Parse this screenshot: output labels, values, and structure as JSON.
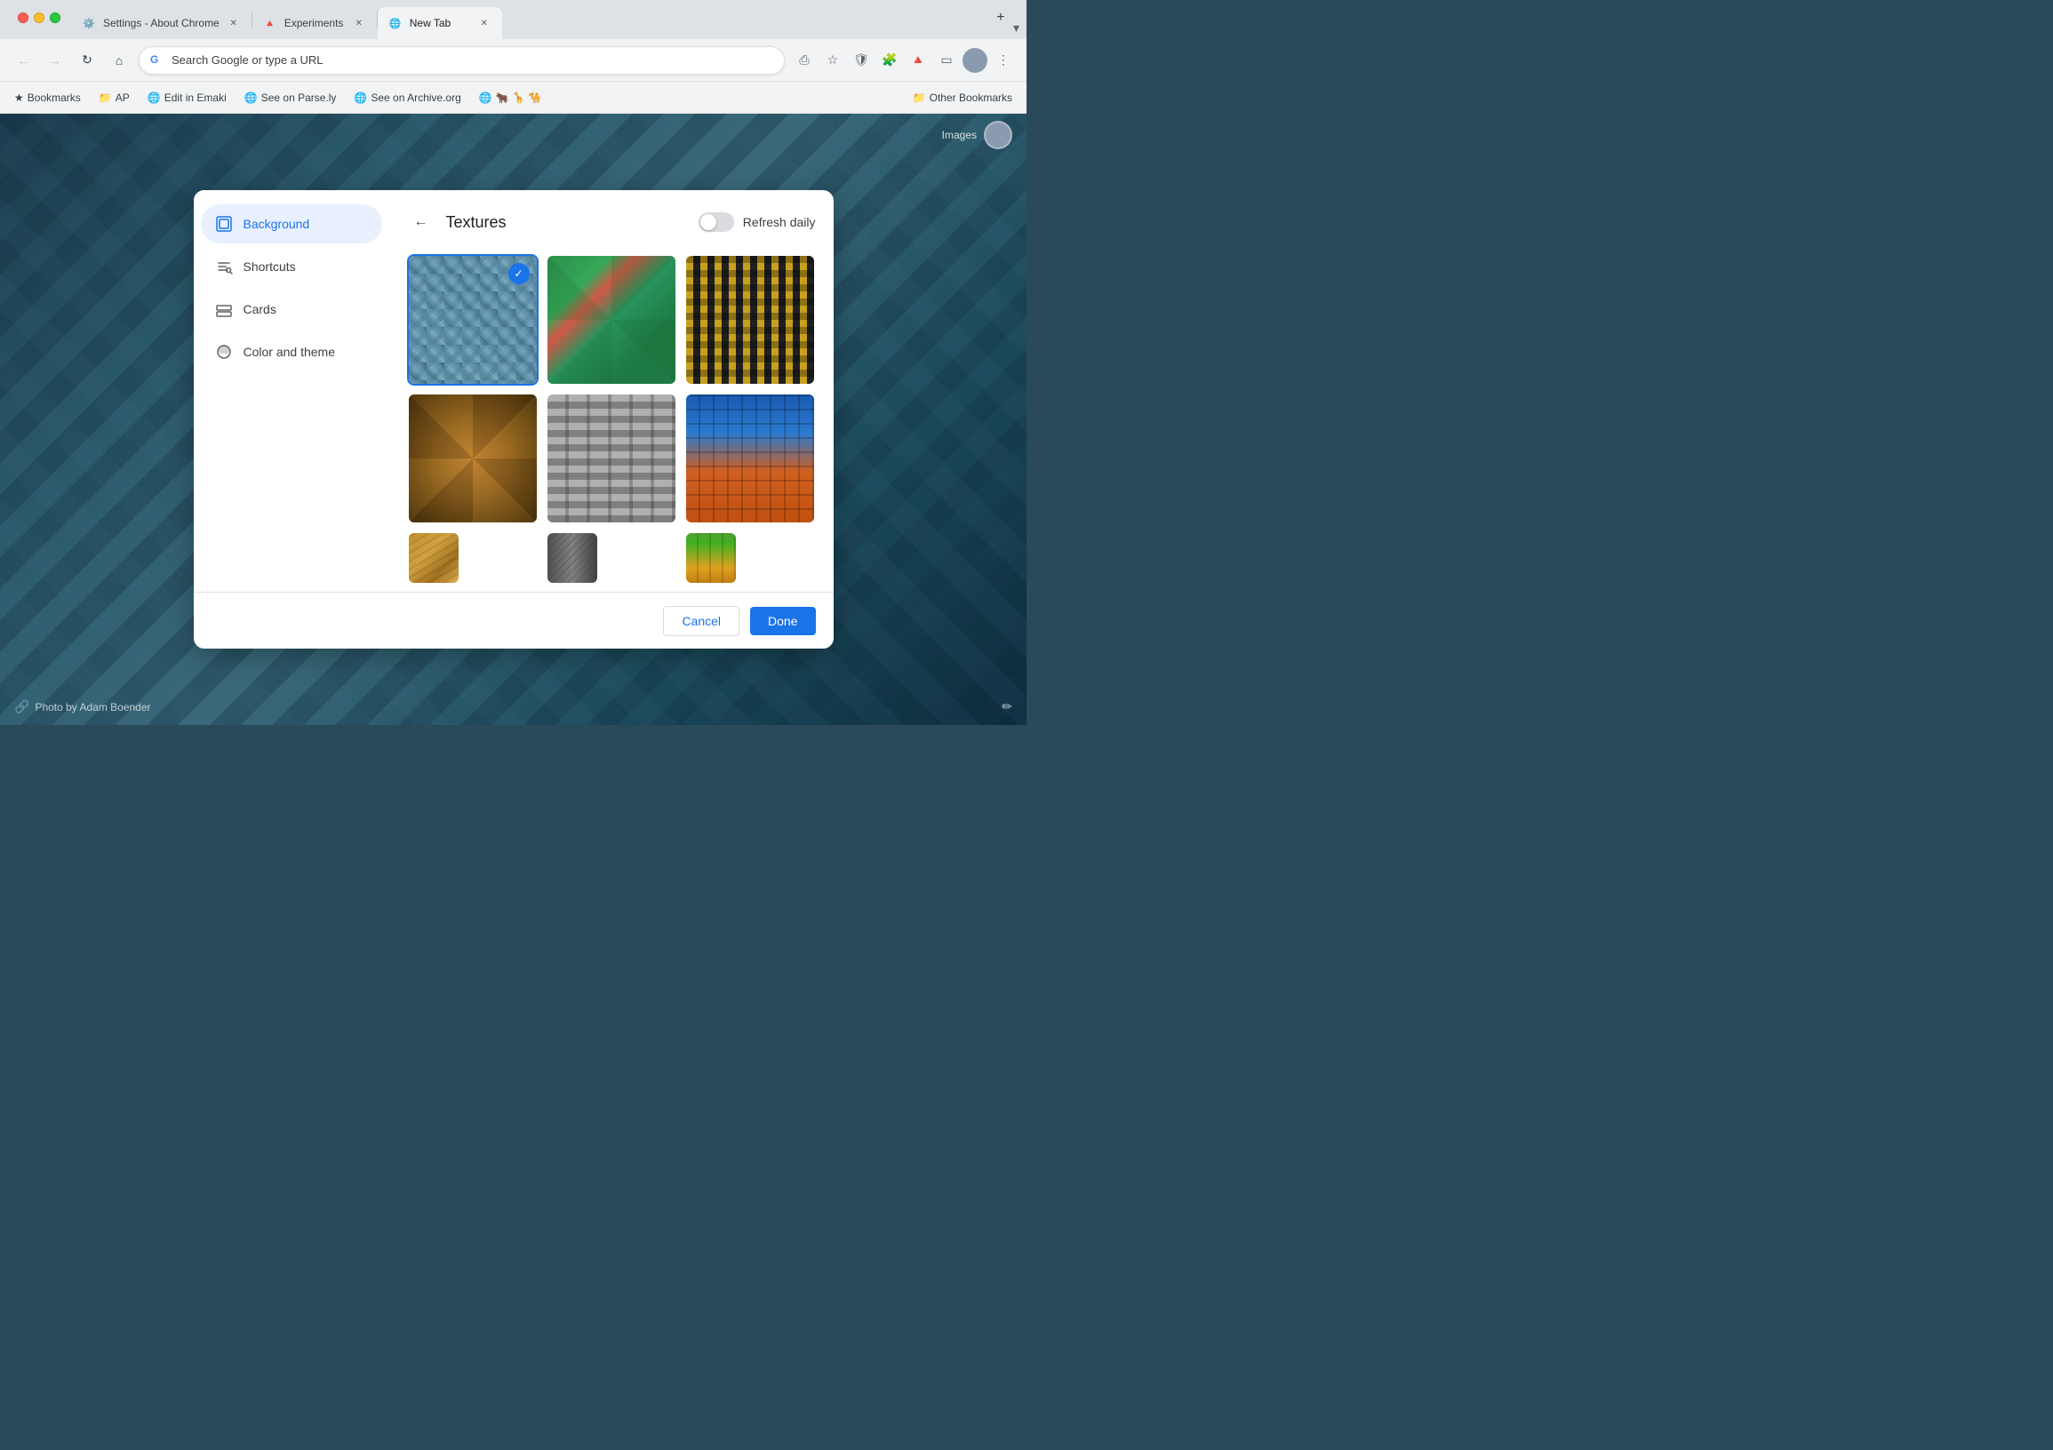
{
  "browser": {
    "tabs": [
      {
        "id": "settings",
        "icon": "⚙️",
        "title": "Settings - About Chrome",
        "active": false
      },
      {
        "id": "experiments",
        "icon": "🔺",
        "title": "Experiments",
        "active": false
      },
      {
        "id": "newtab",
        "icon": "🌐",
        "title": "New Tab",
        "active": true
      }
    ],
    "url": "Search Google or type a URL",
    "bookmarks": [
      {
        "id": "bookmarks",
        "icon": "★",
        "label": "Bookmarks"
      },
      {
        "id": "ap",
        "icon": "📁",
        "label": "AP"
      },
      {
        "id": "edit-emaki",
        "icon": "🌐",
        "label": "Edit in Emaki"
      },
      {
        "id": "parse-ly",
        "icon": "🌐",
        "label": "See on Parse.ly"
      },
      {
        "id": "archive",
        "icon": "🌐",
        "label": "See on Archive.org"
      },
      {
        "id": "animals",
        "icon": "🌐",
        "label": "🐂 🦒 🐪"
      }
    ],
    "other_bookmarks": "Other Bookmarks"
  },
  "ntp": {
    "images_link": "Images",
    "photo_credit": "Photo by Adam Boender"
  },
  "modal": {
    "title": "Textures",
    "back_label": "←",
    "refresh_daily_label": "Refresh daily",
    "sidebar": {
      "items": [
        {
          "id": "background",
          "label": "Background",
          "active": true
        },
        {
          "id": "shortcuts",
          "label": "Shortcuts",
          "active": false
        },
        {
          "id": "cards",
          "label": "Cards",
          "active": false
        },
        {
          "id": "color-theme",
          "label": "Color and theme",
          "active": false
        }
      ]
    },
    "images": [
      {
        "id": "img1",
        "label": "Texture 1 - Building grid",
        "selected": true
      },
      {
        "id": "img2",
        "label": "Texture 2 - Green scales",
        "selected": false
      },
      {
        "id": "img3",
        "label": "Texture 3 - Yellow lattice",
        "selected": false
      },
      {
        "id": "img4",
        "label": "Texture 4 - Dark weave",
        "selected": false
      },
      {
        "id": "img5",
        "label": "Texture 5 - Grey building",
        "selected": false
      },
      {
        "id": "img6",
        "label": "Texture 6 - Blue orange building",
        "selected": false
      },
      {
        "id": "img7",
        "label": "Texture 7 - bottom partial",
        "selected": false
      },
      {
        "id": "img8",
        "label": "Texture 8 - grey partial",
        "selected": false
      },
      {
        "id": "img9",
        "label": "Texture 9 - green partial",
        "selected": false
      }
    ],
    "footer": {
      "cancel_label": "Cancel",
      "done_label": "Done"
    }
  }
}
